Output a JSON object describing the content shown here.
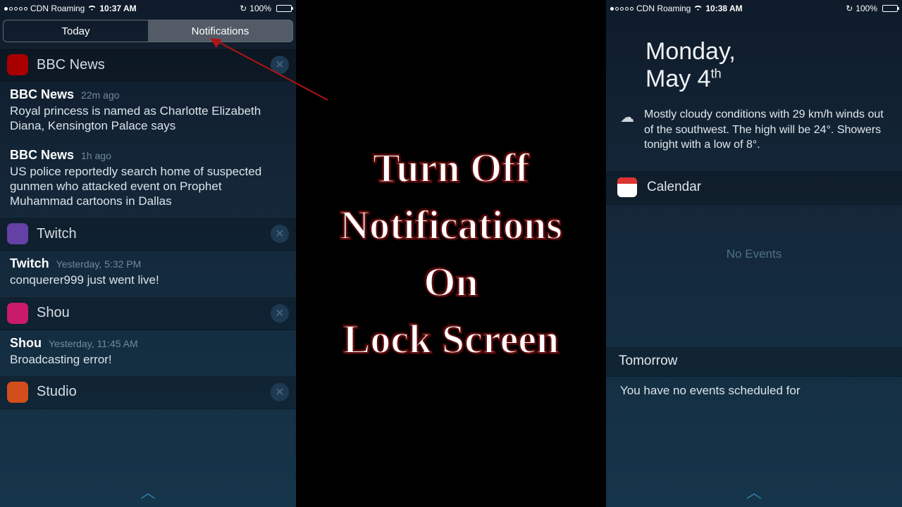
{
  "left": {
    "status": {
      "carrier": "CDN Roaming",
      "time": "10:37 AM",
      "battery": "100%"
    },
    "tabs": {
      "today": "Today",
      "notifications": "Notifications"
    },
    "groups": [
      {
        "icon": "bbc",
        "title": "BBC News",
        "items": [
          {
            "sender": "BBC News",
            "time": "22m ago",
            "body": "Royal princess is named as Charlotte Elizabeth Diana, Kensington Palace says"
          },
          {
            "sender": "BBC News",
            "time": "1h ago",
            "body": "US police reportedly search home of suspected gunmen who attacked event on Prophet Muhammad cartoons in Dallas"
          }
        ]
      },
      {
        "icon": "twitch",
        "title": "Twitch",
        "items": [
          {
            "sender": "Twitch",
            "time": "Yesterday, 5:32 PM",
            "body": "conquerer999 just went live!"
          }
        ]
      },
      {
        "icon": "shou",
        "title": "Shou",
        "items": [
          {
            "sender": "Shou",
            "time": "Yesterday, 11:45 AM",
            "body": "Broadcasting error!"
          }
        ]
      },
      {
        "icon": "studio",
        "title": "Studio",
        "items": []
      }
    ]
  },
  "right": {
    "status": {
      "carrier": "CDN Roaming",
      "time": "10:38 AM",
      "battery": "100%"
    },
    "date": {
      "weekday": "Monday,",
      "monthday": "May 4",
      "ordinal": "th"
    },
    "weather": "Mostly cloudy conditions with 29 km/h winds out of the southwest. The high will be 24°. Showers tonight with a low of 8°.",
    "calendar_label": "Calendar",
    "no_events": "No Events",
    "tomorrow_label": "Tomorrow",
    "tomorrow_body": "You have no events scheduled for"
  },
  "center": {
    "line1": "Turn Off",
    "line2": "Notifications",
    "line3": "On",
    "line4": "Lock Screen"
  }
}
